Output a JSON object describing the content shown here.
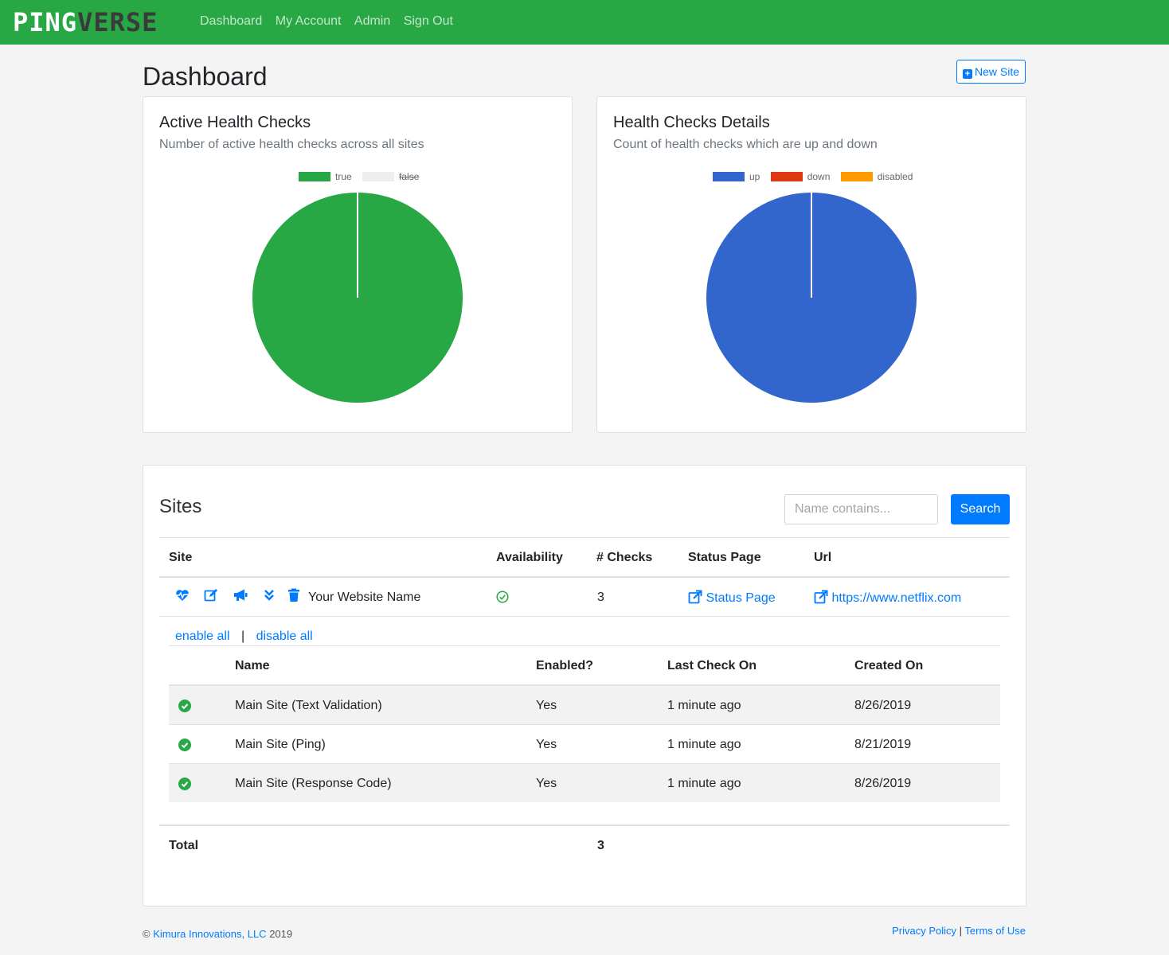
{
  "brand": {
    "part1": "PING",
    "part2": "VERSE"
  },
  "nav": {
    "items": [
      "Dashboard",
      "My Account",
      "Admin",
      "Sign Out"
    ]
  },
  "page": {
    "title": "Dashboard",
    "new_site_label": "New Site"
  },
  "active_card": {
    "title": "Active Health Checks",
    "subtitle": "Number of active health checks across all sites",
    "legend": [
      {
        "label": "true",
        "color": "#28a745"
      },
      {
        "label": "false",
        "color": "#eeeeee"
      }
    ]
  },
  "details_card": {
    "title": "Health Checks Details",
    "subtitle": "Count of health checks which are up and down",
    "legend": [
      {
        "label": "up",
        "color": "#3366cc"
      },
      {
        "label": "down",
        "color": "#dc3912"
      },
      {
        "label": "disabled",
        "color": "#ff9900"
      }
    ]
  },
  "chart_data": [
    {
      "type": "pie",
      "categories": [
        "true",
        "false"
      ],
      "values": [
        3,
        0
      ],
      "colors": [
        "#28a745",
        "#eeeeee"
      ]
    },
    {
      "type": "pie",
      "categories": [
        "up",
        "down",
        "disabled"
      ],
      "values": [
        3,
        0,
        0
      ],
      "colors": [
        "#3366cc",
        "#dc3912",
        "#ff9900"
      ]
    }
  ],
  "sites": {
    "title": "Sites",
    "search_placeholder": "Name contains...",
    "search_label": "Search",
    "columns": [
      "Site",
      "Availability",
      "# Checks",
      "Status Page",
      "Url"
    ],
    "row": {
      "name": "Your Website Name",
      "checks": "3",
      "status_page": "Status Page",
      "url": "https://www.netflix.com"
    },
    "enable_all": "enable all",
    "separator": "|",
    "disable_all": "disable all",
    "sub_columns": [
      "Name",
      "Enabled?",
      "Last Check On",
      "Created On"
    ],
    "checks": [
      {
        "name": "Main Site (Text Validation)",
        "enabled": "Yes",
        "last_check": "1 minute ago",
        "created": "8/26/2019"
      },
      {
        "name": "Main Site (Ping)",
        "enabled": "Yes",
        "last_check": "1 minute ago",
        "created": "8/21/2019"
      },
      {
        "name": "Main Site (Response Code)",
        "enabled": "Yes",
        "last_check": "1 minute ago",
        "created": "8/26/2019"
      }
    ],
    "total_label": "Total",
    "total_value": "3"
  },
  "footer": {
    "copyright": "©",
    "company": "Kimura Innovations, LLC",
    "year": "2019",
    "privacy": "Privacy Policy",
    "sep": "|",
    "terms": "Terms of Use"
  }
}
